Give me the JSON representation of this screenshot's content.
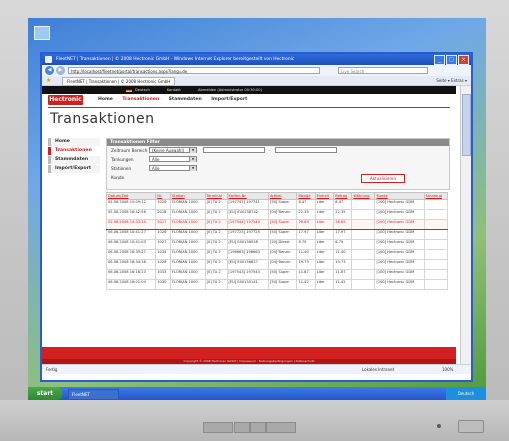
{
  "ie": {
    "window_title": "FleetNET | Transaktionen | © 2008 Hectronic GmbH - Windows Internet Explorer bereitgestellt von Hectronic",
    "url": "http://localhost/fleetnet/portal/transactions.aspx?lang=de",
    "search_placeholder": "Live Search",
    "tab_label": "FleetNET | Transaktionen | © 2008 Hectronic GmbH",
    "command_bar": "Seite ▾  Extras ▾",
    "status_left": "Fertig",
    "status_zone": "Lokales Intranet",
    "zoom": "100%"
  },
  "site": {
    "logo": "Hectronic",
    "topband": {
      "language": "Deutsch",
      "contact": "Kontakt",
      "logout": "Abmelden (Administrator 00:30:00)"
    },
    "nav": [
      "Home",
      "Transaktionen",
      "Stammdaten",
      "Import/Export"
    ],
    "page_title": "Transaktionen",
    "sidebar": [
      "Home",
      "Transaktionen",
      "Stammdaten",
      "Import/Export"
    ]
  },
  "filter": {
    "title": "Transaktionen Filter",
    "labels": {
      "period": "Zeitraum Bereich",
      "type": "Tankungen",
      "station": "Stationen",
      "customer": "Kunde"
    },
    "period_value": "(Keine Auswahl)",
    "type_value": "Alle",
    "station_value": "Alle",
    "range_separator": "-",
    "refresh_label": "Aktualisieren"
  },
  "table": {
    "headers": [
      "Datum/Zeit",
      "Nr.",
      "Station",
      "Terminal",
      "Karten-Nr.",
      "Artikel",
      "Menge",
      "Einheit",
      "Betrag",
      "Währung",
      "Kunde",
      "Fahrzeug"
    ],
    "rows": [
      [
        "05.06.2008 15:09:12",
        "1026",
        "FLORIAN 1000",
        "[0] TA 2",
        "[197741] 197741",
        "[50] Super",
        "8.47",
        "Liter",
        "8.47",
        "",
        "[100] Hectronic GDM",
        ""
      ],
      [
        "05.06.2008 16:42:56",
        "2018",
        "FLORIAN 1000",
        "[0] TA 2",
        "[EU] EV0158742",
        "[04] Benzin",
        "22.35",
        "Liter",
        "22.35",
        "",
        "[100] Hectronic GDM",
        ""
      ],
      [
        "05.06.2008 14:33:20",
        "2017",
        "FLORIAN 1000",
        "[0] TA 2",
        "[197544] 197544",
        "[50] Super",
        "28.69",
        "Liter",
        "28.69",
        "",
        "[100] Hectronic GDM",
        ""
      ],
      [
        "06.06.2008 10:41:27",
        "1026",
        "FLORIAN 1000",
        "[0] TA 2",
        "[197725] 197725",
        "[50] Super",
        "17.97",
        "Liter",
        "17.97",
        "",
        "[100] Hectronic GDM",
        ""
      ],
      [
        "06.06.2008 10:41:03",
        "1027",
        "FLORIAN 1000",
        "[0] TA 2",
        "[EU] E00156558",
        "[20] Diesel",
        "8.79",
        "Liter",
        "8.79",
        "",
        "[100] Hectronic GDM",
        ""
      ],
      [
        "06.06.2008 16:35:27",
        "1034",
        "FLORIAN 1000",
        "[0] TA 2",
        "[196663] 196663",
        "[04] Benzin",
        "11.40",
        "Liter",
        "11.40",
        "",
        "[100] Hectronic GDM",
        ""
      ],
      [
        "06.06.2008 16:34:38",
        "1028",
        "FLORIAN 1000",
        "[0] TA 2",
        "[EU] E00156827",
        "[04] Benzin",
        "19.73",
        "Liter",
        "19.73",
        "",
        "[100] Hectronic GDM",
        ""
      ],
      [
        "06.06.2008 16:18:23",
        "1033",
        "FLORIAN 1000",
        "[0] TA 2",
        "[197543] 197543",
        "[50] Super",
        "11.87",
        "Liter",
        "11.87",
        "",
        "[100] Hectronic GDM",
        ""
      ],
      [
        "06.06.2008 16:01:04",
        "1030",
        "FLORIAN 1000",
        "[0] TA 2",
        "[EU] E00150141",
        "[50] Super",
        "11.42",
        "Liter",
        "11.42",
        "",
        "[100] Hectronic GDM",
        ""
      ]
    ],
    "highlight_row": 2
  },
  "footer": {
    "links": "Copyright © 2008 Hectronic GmbH  |  Impressum · Nutzungsbedingungen  |  Datenschutz"
  },
  "os": {
    "start_label": "start",
    "task_item": "FleetNET",
    "clock": "Deutsch"
  },
  "colors": {
    "brand_red": "#d21f1f",
    "titlebar_blue": "#2f6bdc"
  }
}
